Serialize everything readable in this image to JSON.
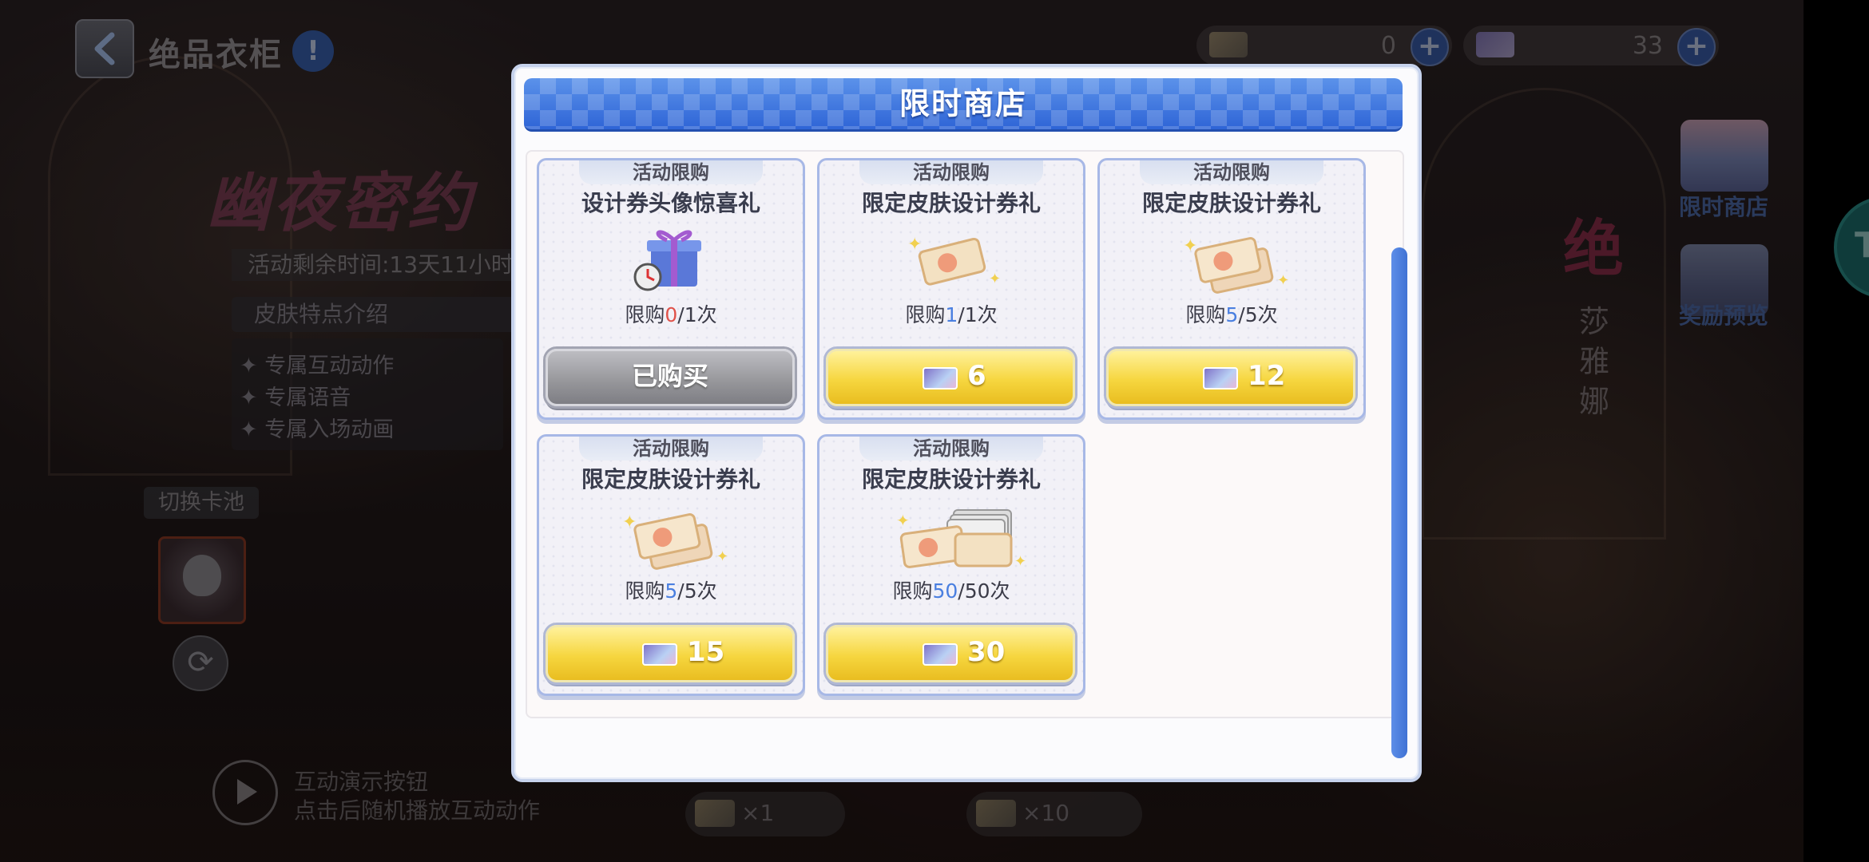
{
  "header": {
    "page_title": "绝品衣柜",
    "info_icon": "!"
  },
  "currencies": [
    {
      "icon": "ticket-gold-icon",
      "value": "0",
      "plus": "+"
    },
    {
      "icon": "ticket-design-icon",
      "value": "33",
      "plus": "+"
    }
  ],
  "left_panel": {
    "event_title": "幽夜密约",
    "time_remaining": "活动剩余时间:13天11小时",
    "skin_intro_label": "皮肤特点介绍",
    "features": [
      "✦ 专属互动动作",
      "✦ 专属语音",
      "✦ 专属入场动画"
    ],
    "switch_pool_label": "切换卡池",
    "refresh_icon": "⟳"
  },
  "interaction": {
    "line1": "互动演示按钮",
    "line2": "点击后随机播放互动动作"
  },
  "right_panel": {
    "char_badge": "绝",
    "char_name": [
      "莎",
      "雅",
      "娜"
    ],
    "shop_label": "限时商店",
    "reward_label": "奖励预览",
    "edge_text": "Tr"
  },
  "bottom_buttons": [
    {
      "label": "×1"
    },
    {
      "label": "×10"
    }
  ],
  "modal": {
    "title": "限时商店",
    "items": [
      {
        "tag": "活动限购",
        "name": "设计券头像惊喜礼",
        "limit_prefix": "限购",
        "bought": "0",
        "limit_suffix": "/1次",
        "count_color": "red",
        "art": "gift-box-icon",
        "state": "purchased",
        "button_label": "已购买",
        "price": ""
      },
      {
        "tag": "活动限购",
        "name": "限定皮肤设计券礼",
        "limit_prefix": "限购",
        "bought": "1",
        "limit_suffix": "/1次",
        "count_color": "blue",
        "art": "ticket-single-icon",
        "state": "buy",
        "button_label": "",
        "price": "6"
      },
      {
        "tag": "活动限购",
        "name": "限定皮肤设计券礼",
        "limit_prefix": "限购",
        "bought": "5",
        "limit_suffix": "/5次",
        "count_color": "blue",
        "art": "ticket-double-icon",
        "state": "buy",
        "button_label": "",
        "price": "12"
      },
      {
        "tag": "活动限购",
        "name": "限定皮肤设计券礼",
        "limit_prefix": "限购",
        "bought": "5",
        "limit_suffix": "/5次",
        "count_color": "blue",
        "art": "ticket-double-icon",
        "state": "buy",
        "button_label": "",
        "price": "15"
      },
      {
        "tag": "活动限购",
        "name": "限定皮肤设计券礼",
        "limit_prefix": "限购",
        "bought": "50",
        "limit_suffix": "/50次",
        "count_color": "blue",
        "art": "ticket-stack-icon",
        "state": "buy",
        "button_label": "",
        "price": "30"
      }
    ]
  },
  "colors": {
    "header_blue": "#2e64d6",
    "button_yellow": "#f6d63f",
    "count_red": "#e0524a",
    "count_blue": "#4a7fe0"
  }
}
